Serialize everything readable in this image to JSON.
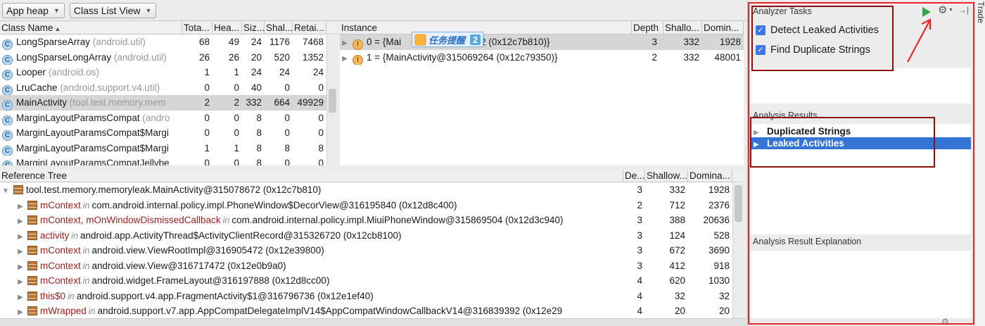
{
  "toolbar": {
    "heap_combo": "App heap",
    "view_combo": "Class List View"
  },
  "class_list": {
    "columns": [
      "Class Name",
      "Tota...",
      "Hea...",
      "Siz...",
      "Shal...",
      "Retai..."
    ],
    "rows": [
      {
        "name": "LongSparseArray",
        "pkg": "(android.util)",
        "total": "68",
        "heap": "49",
        "size": "24",
        "shallow": "1176",
        "retained": "7468"
      },
      {
        "name": "LongSparseLongArray",
        "pkg": "(android.util)",
        "total": "26",
        "heap": "26",
        "size": "20",
        "shallow": "520",
        "retained": "1352"
      },
      {
        "name": "Looper",
        "pkg": "(android.os)",
        "total": "1",
        "heap": "1",
        "size": "24",
        "shallow": "24",
        "retained": "24"
      },
      {
        "name": "LruCache",
        "pkg": "(android.support.v4.util)",
        "total": "0",
        "heap": "0",
        "size": "40",
        "shallow": "0",
        "retained": "0"
      },
      {
        "name": "MainActivity",
        "pkg": "(tool.test.memory.mem",
        "total": "2",
        "heap": "2",
        "size": "332",
        "shallow": "664",
        "retained": "49929"
      },
      {
        "name": "MarginLayoutParamsCompat",
        "pkg": "(andro",
        "total": "0",
        "heap": "0",
        "size": "8",
        "shallow": "0",
        "retained": "0"
      },
      {
        "name": "MarginLayoutParamsCompat$Margi",
        "pkg": "",
        "total": "0",
        "heap": "0",
        "size": "8",
        "shallow": "0",
        "retained": "0"
      },
      {
        "name": "MarginLayoutParamsCompat$Margi",
        "pkg": "",
        "total": "1",
        "heap": "1",
        "size": "8",
        "shallow": "8",
        "retained": "8"
      },
      {
        "name": "MarginLayoutParamsCompatJellybe",
        "pkg": "",
        "total": "0",
        "heap": "0",
        "size": "8",
        "shallow": "0",
        "retained": "0"
      }
    ]
  },
  "instance_list": {
    "columns": [
      "Instance",
      "Depth",
      "Shallo...",
      "Domin..."
    ],
    "rows": [
      {
        "label": "0 = {Mai",
        "label_tail": "672 (0x12c7b810)}",
        "depth": "3",
        "shallow": "332",
        "dominating": "1928"
      },
      {
        "label": "1 = {MainActivity@315069264 (0x12c79350)}",
        "label_tail": "",
        "depth": "2",
        "shallow": "332",
        "dominating": "48001"
      }
    ]
  },
  "popup": {
    "text": "任务提醒",
    "badge": "2"
  },
  "reference_tree": {
    "columns": [
      "Reference Tree",
      "De...",
      "Shallow...",
      "Domina..."
    ],
    "root": {
      "label": "tool.test.memory.memoryleak.MainActivity@315078672 (0x12c7b810)",
      "depth": "3",
      "shallow": "332",
      "dominating": "1928"
    },
    "in_word": "in",
    "rows": [
      {
        "field": "mContext",
        "target": "com.android.internal.policy.impl.PhoneWindow$DecorView@316195840 (0x12d8c400)",
        "depth": "2",
        "shallow": "712",
        "dominating": "2376"
      },
      {
        "field": "mContext, mOnWindowDismissedCallback",
        "target": "com.android.internal.policy.impl.MiuiPhoneWindow@315869504 (0x12d3c940)",
        "depth": "3",
        "shallow": "388",
        "dominating": "20636"
      },
      {
        "field": "activity",
        "target": "android.app.ActivityThread$ActivityClientRecord@315326720 (0x12cb8100)",
        "depth": "3",
        "shallow": "124",
        "dominating": "528"
      },
      {
        "field": "mContext",
        "target": "android.view.ViewRootImpl@316905472 (0x12e39800)",
        "depth": "3",
        "shallow": "672",
        "dominating": "3690"
      },
      {
        "field": "mContext",
        "target": "android.view.View@316717472 (0x12e0b9a0)",
        "depth": "3",
        "shallow": "412",
        "dominating": "918"
      },
      {
        "field": "mContext",
        "target": "android.widget.FrameLayout@316197888 (0x12d8cc00)",
        "depth": "4",
        "shallow": "620",
        "dominating": "1030"
      },
      {
        "field": "this$0",
        "target": "android.support.v4.app.FragmentActivity$1@316796736 (0x12e1ef40)",
        "depth": "4",
        "shallow": "32",
        "dominating": "32"
      },
      {
        "field": "mWrapped",
        "target": "android.support.v7.app.AppCompatDelegateImplV14$AppCompatWindowCallbackV14@316839392 (0x12e29",
        "depth": "4",
        "shallow": "20",
        "dominating": "20"
      }
    ]
  },
  "analyzer": {
    "tasks_title": "Analyzer Tasks",
    "tasks": [
      {
        "label": "Detect Leaked Activities",
        "checked": true
      },
      {
        "label": "Find Duplicate Strings",
        "checked": true
      }
    ],
    "results_title": "Analysis Results",
    "results": [
      {
        "label": "Duplicated Strings",
        "selected": false
      },
      {
        "label": "Leaked Activities",
        "selected": true
      }
    ],
    "explanation_title": "Analysis Result Explanation"
  },
  "side_tab": "Trade",
  "colors": {
    "selection": "#3474d4",
    "annotation_red": "#e8262a",
    "annotation_dark_red": "#8b1010",
    "run_green": "#2fa84a"
  }
}
